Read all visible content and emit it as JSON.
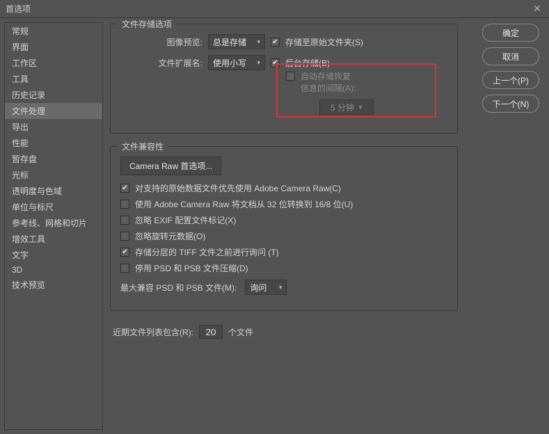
{
  "window": {
    "title": "首选项"
  },
  "sidebar": {
    "items": [
      {
        "label": "常规"
      },
      {
        "label": "界面"
      },
      {
        "label": "工作区"
      },
      {
        "label": "工具"
      },
      {
        "label": "历史记录"
      },
      {
        "label": "文件处理",
        "selected": true
      },
      {
        "label": "导出"
      },
      {
        "label": "性能"
      },
      {
        "label": "暂存盘"
      },
      {
        "label": "光标"
      },
      {
        "label": "透明度与色域"
      },
      {
        "label": "单位与标尺"
      },
      {
        "label": "参考线、网格和切片"
      },
      {
        "label": "增效工具"
      },
      {
        "label": "文字"
      },
      {
        "label": "3D"
      },
      {
        "label": "技术预览"
      }
    ]
  },
  "actions": {
    "ok": "确定",
    "cancel": "取消",
    "prev": "上一个(P)",
    "next": "下一个(N)"
  },
  "saveOptions": {
    "legend": "文件存储选项",
    "imagePreviewLabel": "图像预览:",
    "imagePreviewValue": "总是存储",
    "extLabel": "文件扩展名:",
    "extValue": "使用小写",
    "saveOriginal": "存储至原始文件夹(S)",
    "backgroundSave": "后台存储(B)",
    "autoSaveLine1": "自动存储恢复",
    "autoSaveLine2": "信息的间隔(A):",
    "intervalValue": "5 分钟"
  },
  "compat": {
    "legend": "文件兼容性",
    "cameraRawBtn": "Camera Raw 首选项...",
    "preferACR": "对支持的原始数据文件优先使用 Adobe Camera Raw(C)",
    "use32to16": "使用 Adobe Camera Raw 将文档从 32 位转换到 16/8 位(U)",
    "ignoreExif": "忽略 EXIF 配置文件标记(X)",
    "ignoreRotation": "忽略旋转元数据(O)",
    "askTiff": "存储分层的 TIFF 文件之前进行询问  (T)",
    "disablePsdComp": "停用 PSD 和 PSB 文件压缩(D)",
    "maxCompatLabel": "最大兼容 PSD 和 PSB 文件(M):",
    "maxCompatValue": "询问"
  },
  "recent": {
    "label": "近期文件列表包含(R):",
    "value": "20",
    "suffix": "个文件"
  }
}
